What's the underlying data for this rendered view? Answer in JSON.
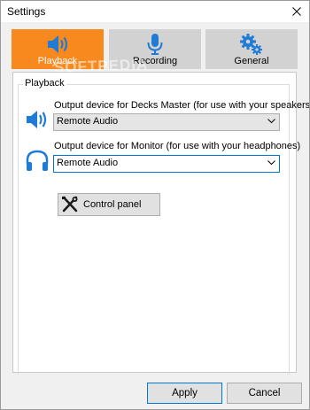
{
  "window": {
    "title": "Settings"
  },
  "tabs": [
    {
      "label": "Playback",
      "icon": "speaker-icon",
      "active": true
    },
    {
      "label": "Recording",
      "icon": "microphone-icon",
      "active": false
    },
    {
      "label": "General",
      "icon": "gears-icon",
      "active": false
    }
  ],
  "playback": {
    "group_title": "Playback",
    "master": {
      "label": "Output device for Decks Master (for use with your speakers)",
      "value": "Remote Audio",
      "icon": "speaker-icon"
    },
    "monitor": {
      "label": "Output device for Monitor (for use with your headphones)",
      "value": "Remote Audio",
      "icon": "headphones-icon"
    },
    "control_panel_label": "Control panel"
  },
  "footer": {
    "apply_label": "Apply",
    "cancel_label": "Cancel"
  },
  "watermark": "SOFTPEDIA",
  "colors": {
    "accent": "#f7891e",
    "icon_blue": "#1e7bd6",
    "focus_blue": "#0078d7"
  }
}
